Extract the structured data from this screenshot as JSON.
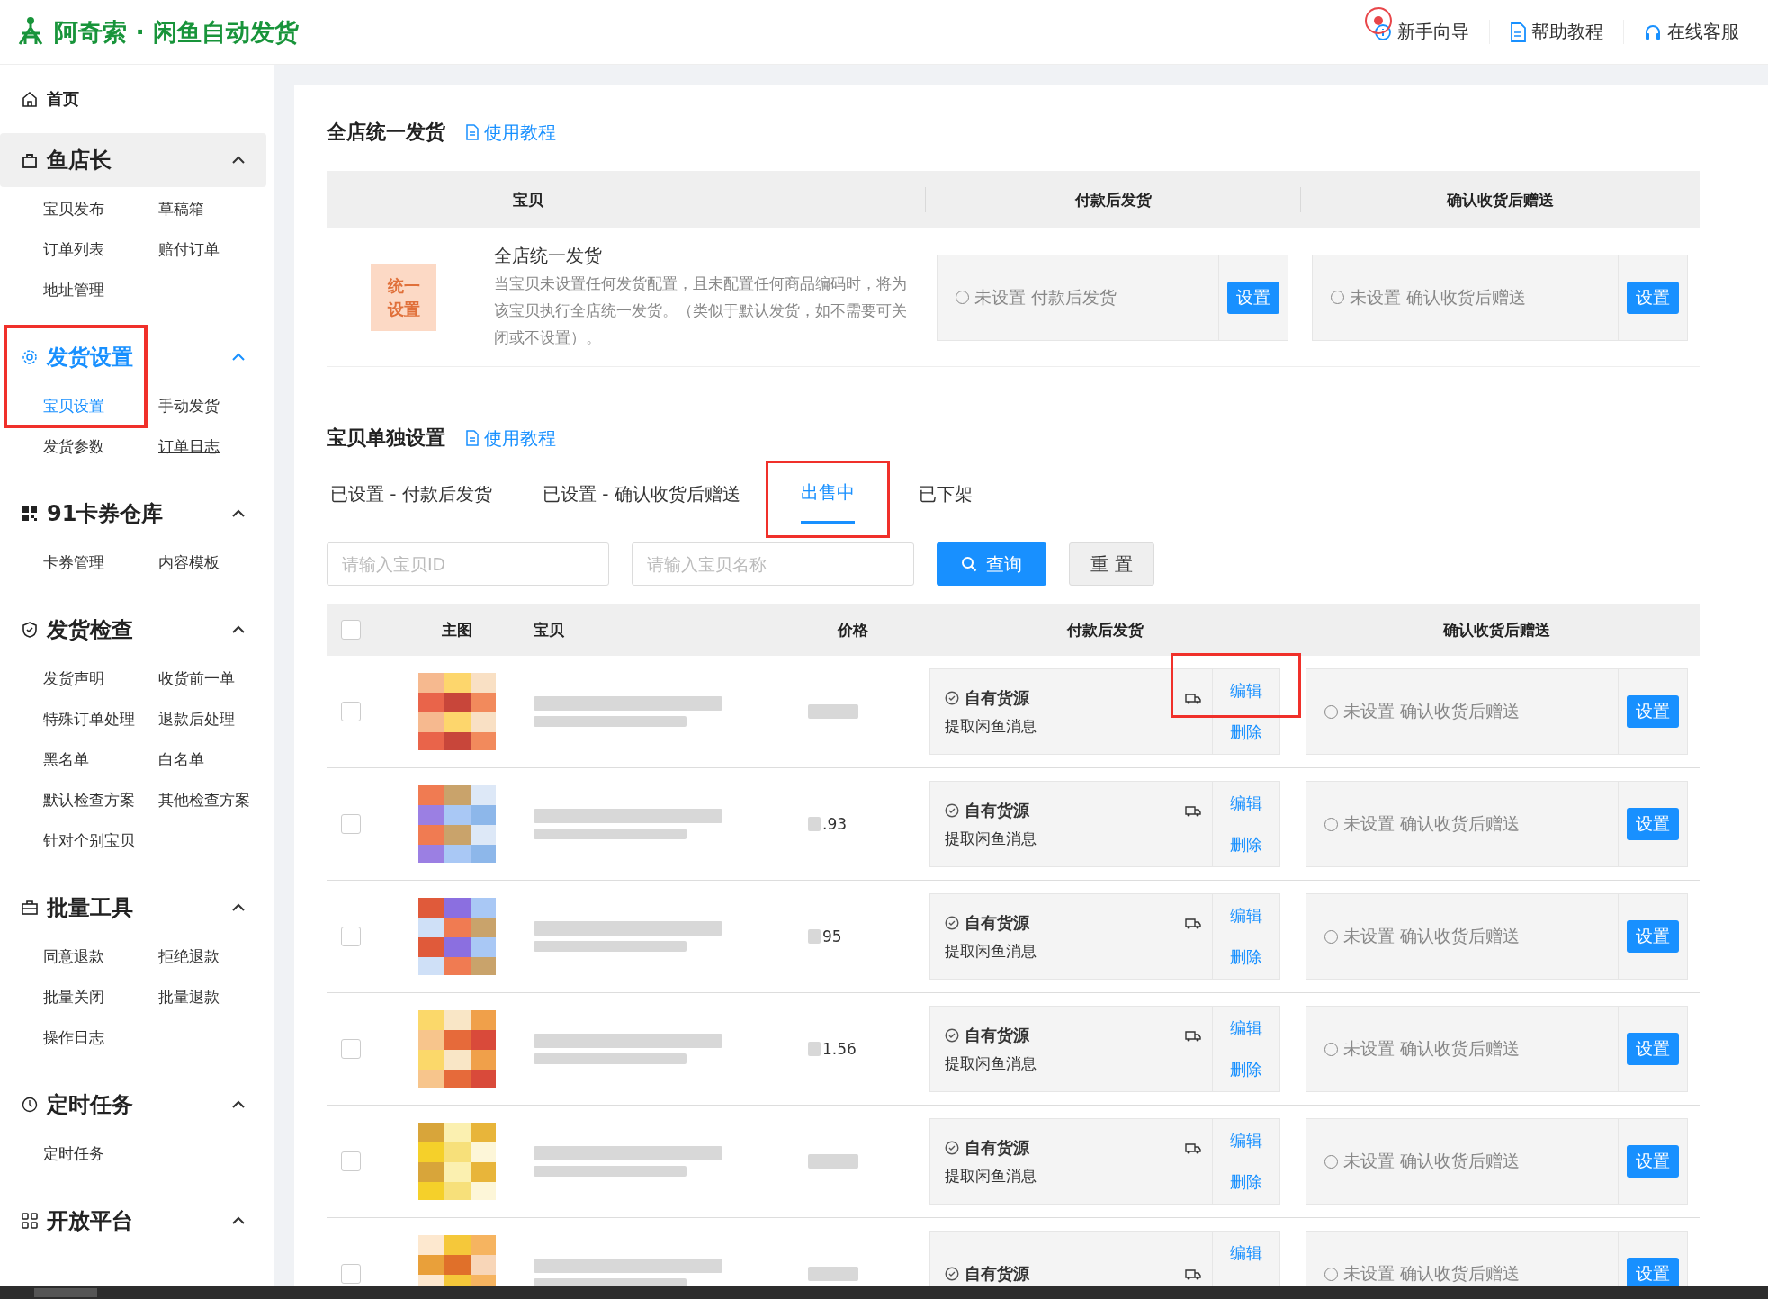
{
  "header": {
    "logo_text": "阿奇索 · 闲鱼自动发货",
    "links": [
      {
        "label": "新手向导",
        "cursor_marker": true
      },
      {
        "label": "帮助教程",
        "cursor_marker": false
      },
      {
        "label": "在线客服",
        "cursor_marker": false
      }
    ]
  },
  "sidebar": {
    "home": {
      "label": "首页"
    },
    "groups": [
      {
        "title": "鱼店长",
        "expanded": true,
        "selected": false,
        "hovered": true,
        "annotated": false,
        "items": [
          {
            "label": "宝贝发布",
            "selected": false,
            "hovered": false
          },
          {
            "label": "草稿箱",
            "selected": false,
            "hovered": false
          },
          {
            "label": "订单列表",
            "selected": false,
            "hovered": false
          },
          {
            "label": "赔付订单",
            "selected": false,
            "hovered": false
          },
          {
            "label": "地址管理",
            "selected": false,
            "hovered": false
          }
        ]
      },
      {
        "title": "发货设置",
        "expanded": true,
        "selected": true,
        "hovered": false,
        "annotated": true,
        "items": [
          {
            "label": "宝贝设置",
            "selected": true,
            "hovered": false
          },
          {
            "label": "手动发货",
            "selected": false,
            "hovered": false
          },
          {
            "label": "发货参数",
            "selected": false,
            "hovered": false
          },
          {
            "label": "订单日志",
            "selected": false,
            "hovered": true
          }
        ]
      },
      {
        "title": "91卡券仓库",
        "expanded": true,
        "selected": false,
        "hovered": false,
        "annotated": false,
        "items": [
          {
            "label": "卡券管理",
            "selected": false,
            "hovered": false
          },
          {
            "label": "内容模板",
            "selected": false,
            "hovered": false
          }
        ]
      },
      {
        "title": "发货检查",
        "expanded": true,
        "selected": false,
        "hovered": false,
        "annotated": false,
        "items": [
          {
            "label": "发货声明",
            "selected": false,
            "hovered": false
          },
          {
            "label": "收货前一单",
            "selected": false,
            "hovered": false
          },
          {
            "label": "特殊订单处理",
            "selected": false,
            "hovered": false
          },
          {
            "label": "退款后处理",
            "selected": false,
            "hovered": false
          },
          {
            "label": "黑名单",
            "selected": false,
            "hovered": false
          },
          {
            "label": "白名单",
            "selected": false,
            "hovered": false
          },
          {
            "label": "默认检查方案",
            "selected": false,
            "hovered": false
          },
          {
            "label": "其他检查方案",
            "selected": false,
            "hovered": false
          },
          {
            "label": "针对个别宝贝",
            "selected": false,
            "hovered": false
          }
        ]
      },
      {
        "title": "批量工具",
        "expanded": true,
        "selected": false,
        "hovered": false,
        "annotated": false,
        "items": [
          {
            "label": "同意退款",
            "selected": false,
            "hovered": false
          },
          {
            "label": "拒绝退款",
            "selected": false,
            "hovered": false
          },
          {
            "label": "批量关闭",
            "selected": false,
            "hovered": false
          },
          {
            "label": "批量退款",
            "selected": false,
            "hovered": false
          },
          {
            "label": "操作日志",
            "selected": false,
            "hovered": false
          }
        ]
      },
      {
        "title": "定时任务",
        "expanded": true,
        "selected": false,
        "hovered": false,
        "annotated": false,
        "items": [
          {
            "label": "定时任务",
            "selected": false,
            "hovered": false
          }
        ]
      },
      {
        "title": "开放平台",
        "expanded": true,
        "selected": false,
        "hovered": false,
        "annotated": false
      }
    ]
  },
  "unified": {
    "title": "全店统一发货",
    "tutorial_link": "使用教程",
    "columns": [
      "宝贝",
      "付款后发货",
      "确认收货后赠送"
    ],
    "row": {
      "badge_lines": [
        "统一",
        "设置"
      ],
      "name": "全店统一发货",
      "description": "当宝贝未设置任何发货配置，且未配置任何商品编码时，将为该宝贝执行全店统一发货。（类似于默认发货，如不需要可关闭或不设置）。",
      "pay_setting": {
        "status": "未设置 付款后发货",
        "button": "设置"
      },
      "confirm_setting": {
        "status": "未设置 确认收货后赠送",
        "button": "设置"
      }
    }
  },
  "items": {
    "title": "宝贝单独设置",
    "tutorial_link": "使用教程",
    "tabs": [
      {
        "label": "已设置 - 付款后发货",
        "selected": false,
        "annotated": false
      },
      {
        "label": "已设置 - 确认收货后赠送",
        "selected": false,
        "annotated": false
      },
      {
        "label": "出售中",
        "selected": true,
        "annotated": true
      },
      {
        "label": "已下架",
        "selected": false,
        "annotated": false
      }
    ],
    "search": {
      "id_placeholder": "请输入宝贝ID",
      "name_placeholder": "请输入宝贝名称",
      "query_button": "查询",
      "reset_button": "重 置"
    },
    "select_all_checked": false,
    "columns": [
      "主图",
      "宝贝",
      "价格",
      "付款后发货",
      "确认收货后赠送"
    ],
    "rows": [
      {
        "checked": false,
        "pay": {
          "source": "自有货源",
          "action": "提取闲鱼消息",
          "edit": "编辑",
          "delete": "删除"
        },
        "confirm": {
          "status": "未设置 确认收货后赠送",
          "button": "设置"
        },
        "edit_annotated": true
      },
      {
        "checked": false,
        "price_fragment": ".93",
        "pay": {
          "source": "自有货源",
          "action": "提取闲鱼消息",
          "edit": "编辑",
          "delete": "删除"
        },
        "confirm": {
          "status": "未设置 确认收货后赠送",
          "button": "设置"
        },
        "edit_annotated": false
      },
      {
        "checked": false,
        "price_fragment": "95",
        "pay": {
          "source": "自有货源",
          "action": "提取闲鱼消息",
          "edit": "编辑",
          "delete": "删除"
        },
        "confirm": {
          "status": "未设置 确认收货后赠送",
          "button": "设置"
        },
        "edit_annotated": false
      },
      {
        "checked": false,
        "price_fragment": "1.56",
        "pay": {
          "source": "自有货源",
          "action": "提取闲鱼消息",
          "edit": "编辑",
          "delete": "删除"
        },
        "confirm": {
          "status": "未设置 确认收货后赠送",
          "button": "设置"
        },
        "edit_annotated": false
      },
      {
        "checked": false,
        "pay": {
          "source": "自有货源",
          "action": "提取闲鱼消息",
          "edit": "编辑",
          "delete": "删除"
        },
        "confirm": {
          "status": "未设置 确认收货后赠送",
          "button": "设置"
        },
        "edit_annotated": false
      },
      {
        "checked": false,
        "pay": {
          "source": "自有货源",
          "edit": "编辑"
        },
        "confirm": {
          "status": "未设置 确认收货后赠送",
          "button": "设置"
        },
        "edit_annotated": false
      }
    ]
  }
}
